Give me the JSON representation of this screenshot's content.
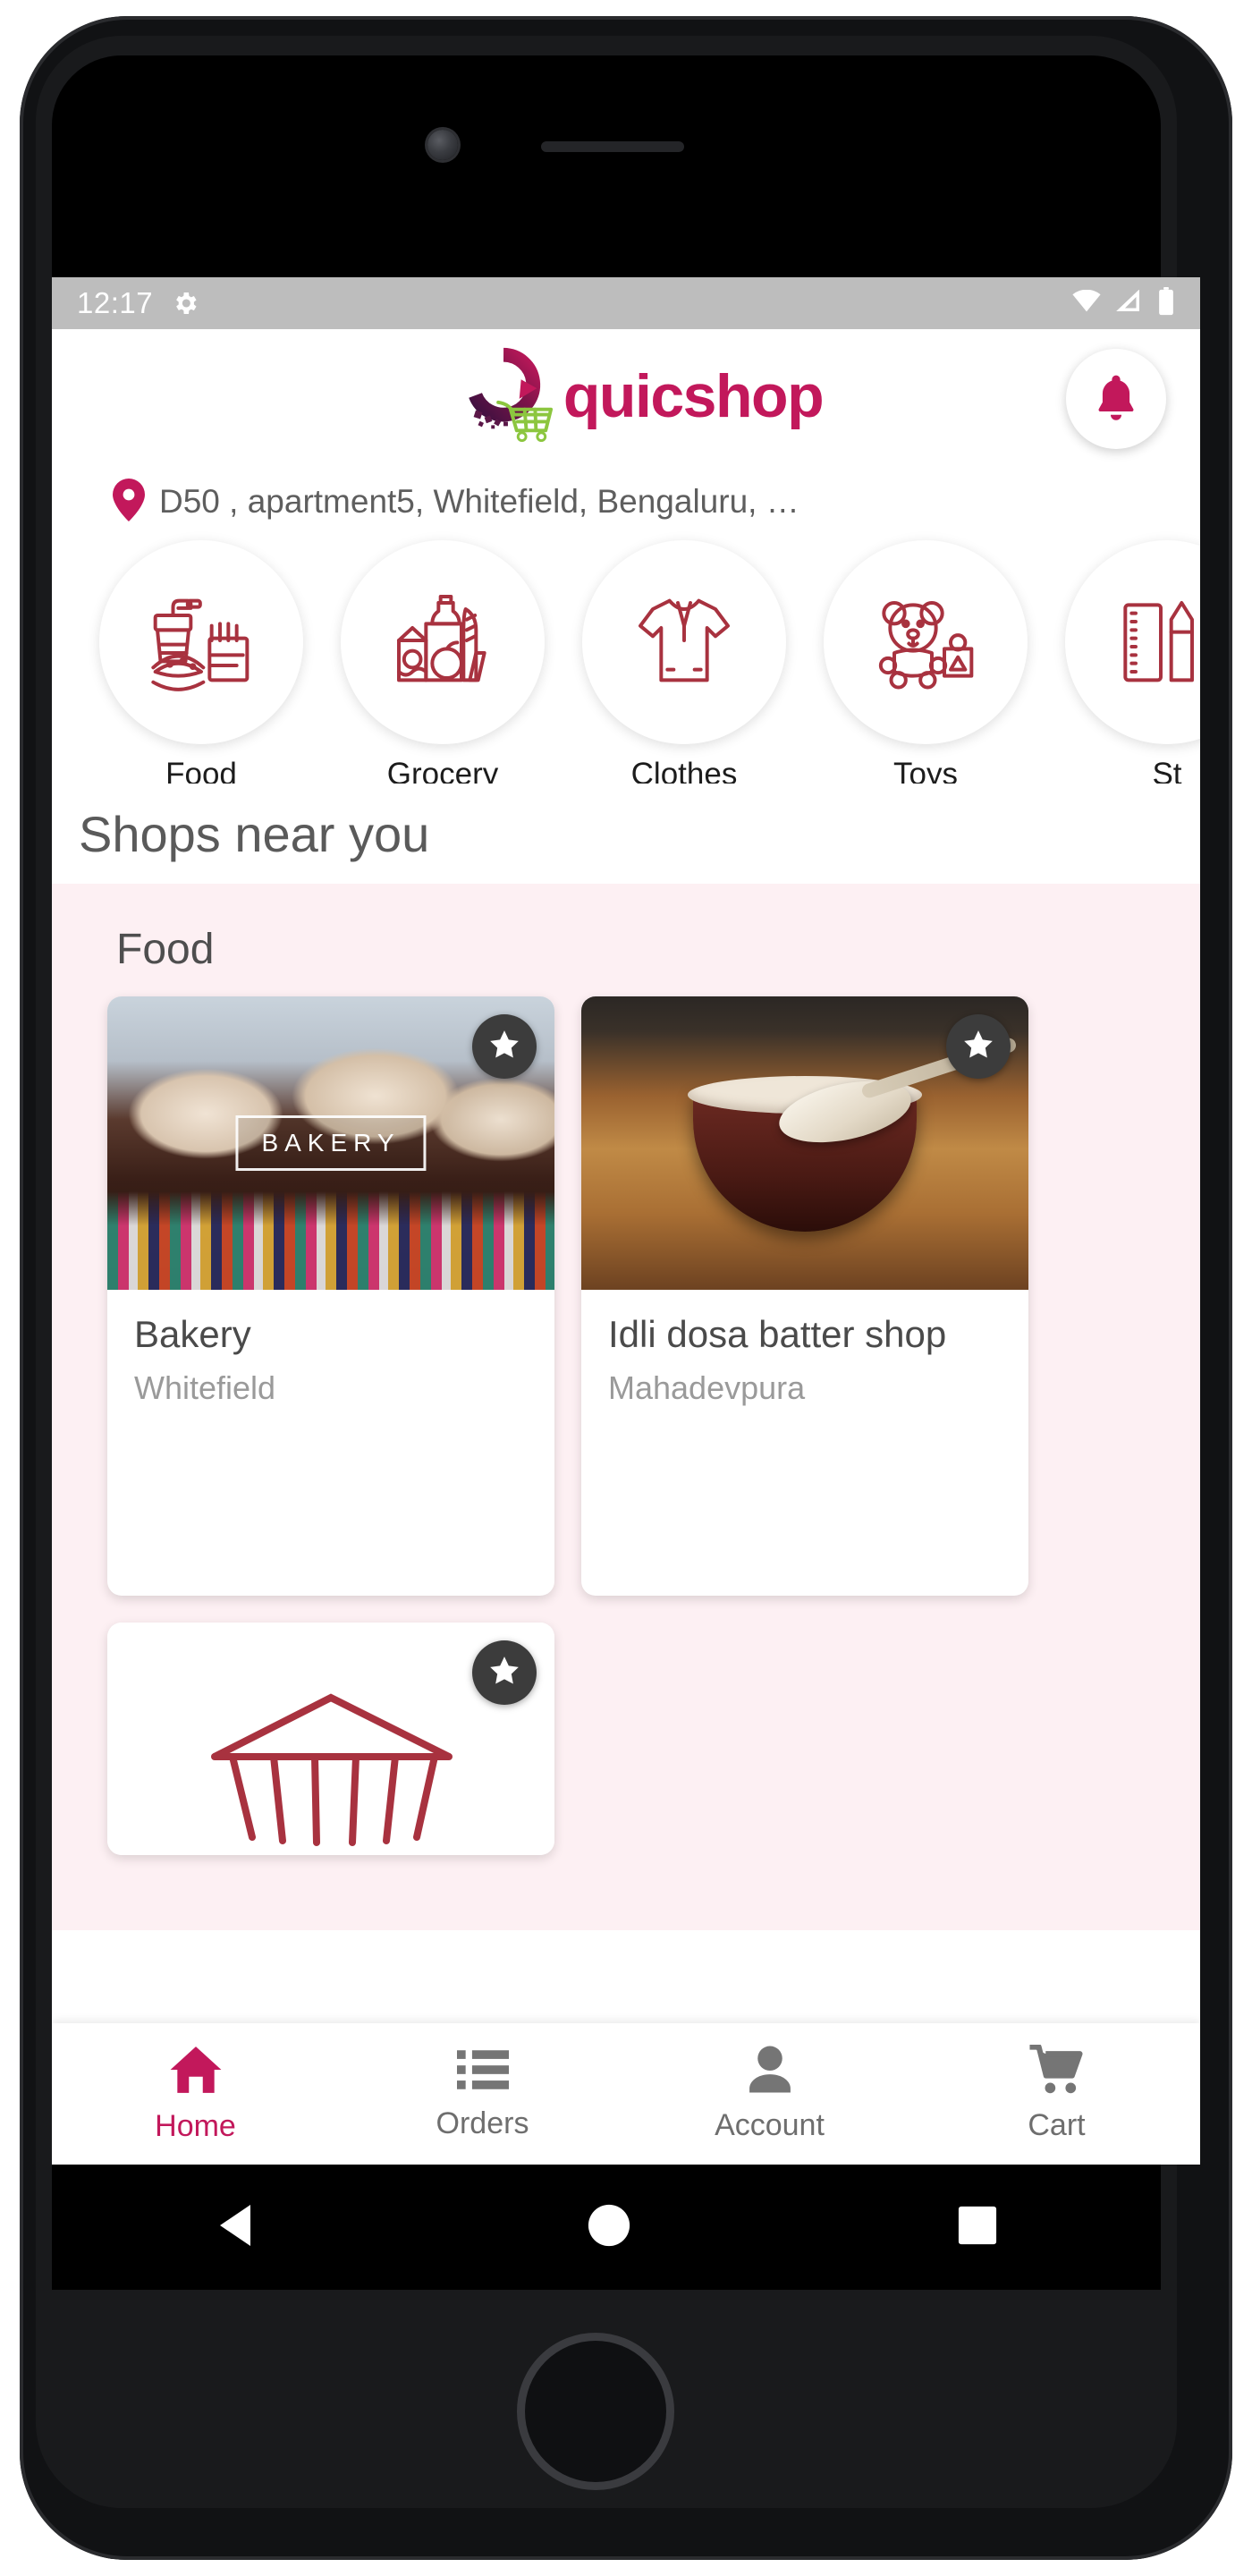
{
  "status_bar": {
    "time": "12:17",
    "gear_icon": "gear-icon",
    "wifi_icon": "wifi-icon",
    "signal_icon": "signal-icon",
    "battery_icon": "battery-icon"
  },
  "header": {
    "brand_name": "quicshop",
    "logo_icon": "quicshop-logo-icon",
    "notification_icon": "bell-icon",
    "brand_color": "#c2185b",
    "logo_cart_color": "#8cc63f"
  },
  "address": {
    "pin_icon": "location-pin-icon",
    "text": "D50 , apartment5, Whitefield, Bengaluru, …"
  },
  "categories": [
    {
      "label": "Food",
      "icon": "food-burger-icon"
    },
    {
      "label": "Grocery",
      "icon": "grocery-bag-icon"
    },
    {
      "label": "Clothes",
      "icon": "tshirt-icon"
    },
    {
      "label": "Toys",
      "icon": "teddy-bear-icon"
    },
    {
      "label": "St",
      "icon": "stationery-icon"
    }
  ],
  "section": {
    "heading": "Shops near you"
  },
  "groups": [
    {
      "title": "Food",
      "shops": [
        {
          "name": "Bakery",
          "area": "Whitefield",
          "thumb_label": "BAKERY",
          "favorite_icon": "star-icon",
          "thumb": "bakery-cupcakes-photo"
        },
        {
          "name": "Idli dosa batter shop",
          "area": "Mahadevpura",
          "favorite_icon": "star-icon",
          "thumb": "idli-batter-bowl-photo"
        },
        {
          "name": "",
          "area": "",
          "favorite_icon": "star-icon",
          "thumb": "store-awning-illustration"
        }
      ]
    }
  ],
  "bottom_nav": [
    {
      "label": "Home",
      "icon": "home-icon",
      "active": true
    },
    {
      "label": "Orders",
      "icon": "list-icon",
      "active": false
    },
    {
      "label": "Account",
      "icon": "person-icon",
      "active": false
    },
    {
      "label": "Cart",
      "icon": "shopping-cart-icon",
      "active": false
    }
  ],
  "system_nav": {
    "back_icon": "back-triangle-icon",
    "home_icon": "home-circle-icon",
    "recents_icon": "recents-square-icon"
  },
  "colors": {
    "accent": "#c2185b",
    "group_background": "#fdf0f3",
    "status_bar": "#bdbdbd"
  }
}
